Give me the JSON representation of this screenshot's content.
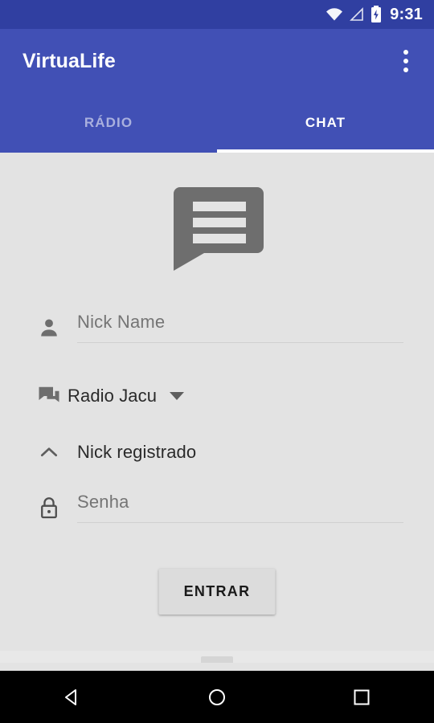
{
  "status_bar": {
    "time": "9:31",
    "icons": [
      {
        "name": "wifi-icon",
        "label": "wifi"
      },
      {
        "name": "cellular-signal-icon",
        "label": "cellular signal"
      },
      {
        "name": "battery-charging-icon",
        "label": "battery charging"
      }
    ],
    "background": "#303FA1"
  },
  "app_bar": {
    "title": "VirtuaLife",
    "overflow_menu_name": "more-options",
    "background": "#4150B5"
  },
  "tabs": [
    {
      "label": "RÁDIO",
      "active": false
    },
    {
      "label": "CHAT",
      "active": true
    }
  ],
  "content": {
    "hero_icon": "chat-bubble-icon",
    "nickname": {
      "icon": "person-icon",
      "value": "",
      "placeholder": "Nick Name"
    },
    "station": {
      "icon": "forum-icon",
      "selected": "Radio Jacu",
      "caret": "chevron-down-icon"
    },
    "registered": {
      "icon": "chevron-up-icon",
      "label": "Nick registrado"
    },
    "password": {
      "icon": "lock-icon",
      "value": "",
      "placeholder": "Senha"
    },
    "submit_label": "ENTRAR"
  },
  "nav_bar": {
    "back": "back-triangle",
    "home": "home-circle",
    "recents": "recents-square",
    "background": "#000000"
  },
  "colors": {
    "primary": "#4150B5",
    "primary_dark": "#303FA1",
    "content_background": "#E3E3E3",
    "button_background": "#DCDCDC",
    "placeholder_text": "#AEAEAE",
    "icon_gray": "#6E6E6E"
  }
}
